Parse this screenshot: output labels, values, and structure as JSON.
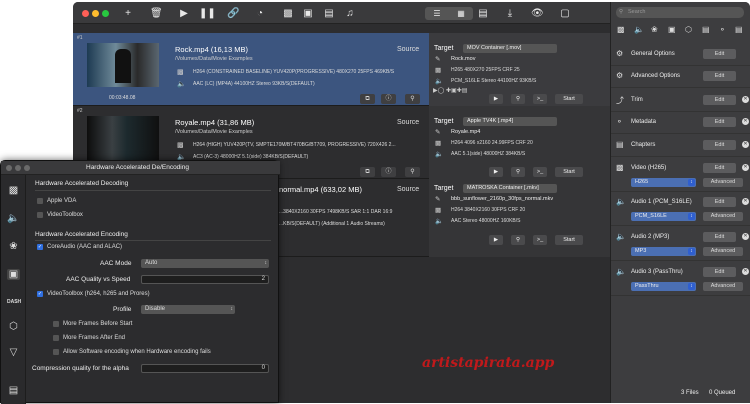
{
  "toolbar": {
    "icons": [
      "add-icon",
      "trash-icon",
      "play-icon",
      "pause-icon",
      "link-icon",
      "gauge-icon",
      "video-icon",
      "image-video-icon",
      "subtitle-icon",
      "audio-icon"
    ],
    "right_icons": [
      "list-icon",
      "grid-icon",
      "film-icon",
      "export-icon",
      "eye-icon",
      "fullscreen-icon"
    ]
  },
  "queue": [
    {
      "num": "#1",
      "name": "Rock.mp4 (16,13 MB)",
      "path": "/Volumes/Data/Movie Examples",
      "video": "H264 (CONSTRAINED BASELINE) YUV420P(PROGRESSIVE) 480X270  25FPS 469KB/S",
      "audio": "AAC (LC) (MP4A) 44100HZ Stereo 93KB/S(DEFAULT)",
      "source": "Source",
      "time": "00:03:48.08",
      "target": {
        "label": "Target",
        "container": "MOV Container [.mov]",
        "name": "Rock.mov",
        "video": "H265 480X270 25FPS CRF 25",
        "audio": "PCM_S16LE Stereo 44100HZ 93KB/S",
        "start": "Start"
      }
    },
    {
      "num": "#2",
      "name": "Royale.mp4 (31,86 MB)",
      "path": "/Volumes/Data/Movie Examples",
      "video": "H264 (HIGH) YUV420P(TV, SMPTE170M/BT470BG/BT709, PROGRESSIVE) 720X426  2...",
      "audio": "AC3 (AC-3) 48000HZ 5.1(side) 384KB/S(DEFAULT)",
      "source": "Source",
      "target": {
        "label": "Target",
        "container": "Apple TV4K [.mp4]",
        "name": "Royale.mp4",
        "video": "H264 4096 x2160  24.99FPS CRF 20",
        "audio": "AAC 5.1(side) 48000HZ 384KB/S",
        "start": "Start"
      }
    },
    {
      "num": "",
      "name": "normal.mp4 (633,02 MB)",
      "path": "",
      "video": "...3840X2160  30FPS 7498KB/S SAR 1:1 DAR 16:9",
      "audio": "...KB/S(DEFAULT) (Additional 1 Audio Streams)",
      "source": "Source",
      "target": {
        "label": "Target",
        "container": "MATROSKA Container [.mkv]",
        "name": "bbb_sunflower_2160p_30fps_normal.mkv",
        "video": "H264 3840X2160 30FPS CRF 20",
        "audio": "AAC Stereo 48000HZ 160KB/S",
        "start": "Start"
      }
    }
  ],
  "sidebar": {
    "search_placeholder": "Search",
    "items": [
      {
        "label": "General Options",
        "edit": "Edit"
      },
      {
        "label": "Advanced Options",
        "edit": "Edit"
      },
      {
        "label": "Trim",
        "edit": "Edit"
      },
      {
        "label": "Metadata",
        "edit": "Edit"
      },
      {
        "label": "Chapters",
        "edit": "Edit"
      },
      {
        "label": "Video (H265)",
        "edit": "Edit",
        "codec": "H265",
        "advanced": "Advanced"
      },
      {
        "label": "Audio 1 (PCM_S16LE)",
        "edit": "Edit",
        "codec": "PCM_S16LE",
        "advanced": "Advanced"
      },
      {
        "label": "Audio 2 (MP3)",
        "edit": "Edit",
        "codec": "MP3",
        "advanced": "Advanced"
      },
      {
        "label": "Audio 3 (PassThru)",
        "edit": "Edit",
        "codec": "PassThru",
        "advanced": "Advanced"
      }
    ],
    "files": "3 Files",
    "queued": "0 Queued"
  },
  "hw": {
    "title": "Hardware Accelerated De/Encoding",
    "decoding_header": "Hardware Accelerated Decoding",
    "apple_vda": "Apple VDA",
    "videotoolbox": "VideoToolbox",
    "encoding_header": "Hardware Accelerated Encoding",
    "coreaudio": "CoreAudio (AAC and ALAC)",
    "aac_mode_label": "AAC Mode",
    "aac_mode_value": "Auto",
    "aac_quality_label": "AAC Quality vs Speed",
    "aac_quality_value": "2",
    "vt_encode": "VideoToolbox (h264, h265 and Prores)",
    "profile_label": "Profile",
    "profile_value": "Disable",
    "more_before": "More Frames Before Start",
    "more_after": "More Frames After End",
    "allow_sw": "Allow Software encoding when Hardware encoding fails",
    "alpha_label": "Compression quality for the alpha",
    "alpha_value": "0",
    "nav_icons": [
      "video-camera-icon",
      "speaker-icon",
      "aperture-icon",
      "chip-icon",
      "dash-icon",
      "cube-icon",
      "filter-icon",
      "document-icon"
    ]
  },
  "watermark": "artistapirata.app"
}
